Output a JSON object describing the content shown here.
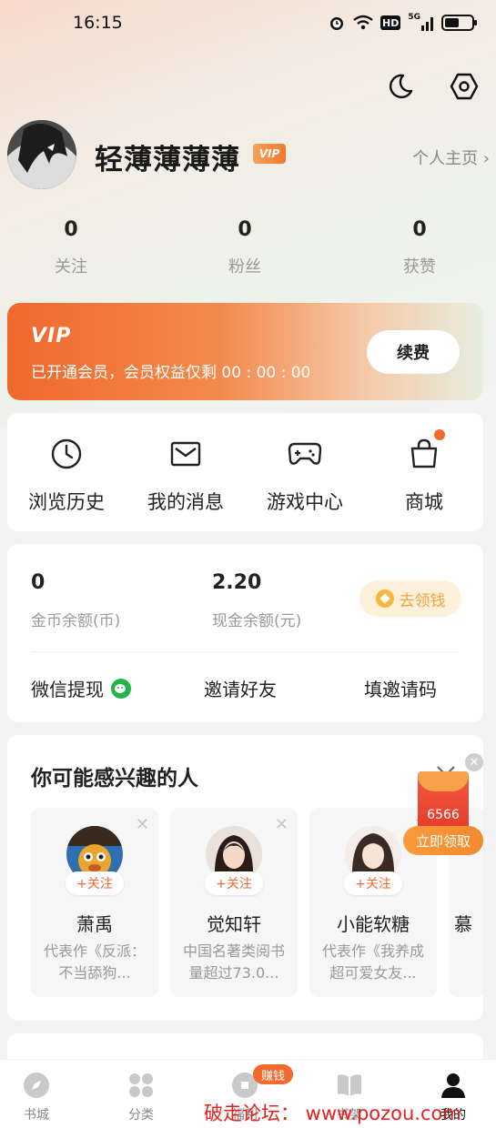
{
  "status_bar": {
    "time": "16:15",
    "icons": [
      "alarm-icon",
      "wifi-icon",
      "hd-icon",
      "5g-signal-icon",
      "battery-icon"
    ],
    "hd_label": "HD",
    "net_label": "5G",
    "battery_level": 0.55
  },
  "top_actions": {
    "night_mode_icon": "moon-icon",
    "settings_icon": "settings-icon"
  },
  "profile": {
    "username": "轻薄薄薄薄",
    "vip_badge": "VIP",
    "homepage_link": "个人主页 ›"
  },
  "stats": [
    {
      "value": "0",
      "label": "关注"
    },
    {
      "value": "0",
      "label": "粉丝"
    },
    {
      "value": "0",
      "label": "获赞"
    }
  ],
  "vip_card": {
    "logo": "VIP",
    "text": "已开通会员，会员权益仅剩 00 : 00 : 00",
    "button": "续费"
  },
  "quick_actions": [
    {
      "label": "浏览历史",
      "icon": "clock-icon"
    },
    {
      "label": "我的消息",
      "icon": "mail-icon"
    },
    {
      "label": "游戏中心",
      "icon": "gamepad-icon"
    },
    {
      "label": "商城",
      "icon": "shopping-bag-icon"
    }
  ],
  "wallet": {
    "coin_balance": "0",
    "coin_label": "金币余额(币)",
    "cash_balance": "2.20",
    "cash_label": "现金余额(元)",
    "claim_button": "去领钱",
    "actions": [
      "微信提现",
      "邀请好友",
      "填邀请码"
    ]
  },
  "interest": {
    "title": "你可能感兴趣的人",
    "follow_label": "+关注",
    "people": [
      {
        "name": "萧禹",
        "desc": "代表作《反派：不当舔狗..."
      },
      {
        "name": "觉知轩",
        "desc": "中国名著类阅书量超过73.0..."
      },
      {
        "name": "小能软糖",
        "desc": "代表作《我养成超可爱女友..."
      },
      {
        "name": "慕"
      }
    ]
  },
  "red_packet": {
    "amount": "6566",
    "button": "立即领取"
  },
  "tabbar": {
    "items": [
      {
        "label": "书城",
        "icon": "compass-icon"
      },
      {
        "label": "分类",
        "icon": "grid-icon"
      },
      {
        "label": "福利",
        "icon": "gift-icon"
      },
      {
        "label": "书架",
        "icon": "book-icon"
      },
      {
        "label": "我的",
        "icon": "person-icon"
      }
    ],
    "earn_badge": "赚钱",
    "active": "我的"
  },
  "watermark": "破走论坛： www.pozou.com",
  "colors": {
    "accent": "#f26a2e",
    "vip_gradient_start": "#f0682c",
    "coin": "#f6b73c",
    "wechat": "#22b34b"
  }
}
